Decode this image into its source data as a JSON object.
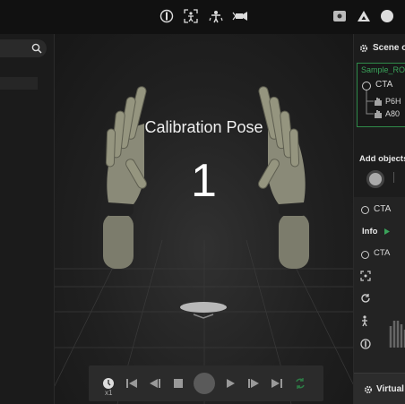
{
  "toolbar": {
    "icons": [
      "record-mode-icon",
      "body-tracking-icon",
      "retarget-icon",
      "camera-icon",
      "screenshot-icon",
      "vive-logo-icon",
      "profile-icon"
    ]
  },
  "viewport": {
    "pose_label": "Calibration Pose",
    "countdown": "1"
  },
  "playback": {
    "speed": "x1",
    "icons": [
      "timer-icon",
      "skip-back-icon",
      "step-back-icon",
      "stop-icon",
      "record-button-icon",
      "play-icon",
      "step-forward-icon",
      "skip-forward-icon",
      "loop-icon"
    ]
  },
  "scene_panel": {
    "title": "Scene o",
    "tree_root": "Sample_RO",
    "tree_items": [
      "CTA",
      "P6H",
      "A80"
    ],
    "add_objects": "Add objects",
    "selected_object": "CTA",
    "info_label": "Info",
    "info_object": "CTA",
    "virtual_label": "Virtual"
  }
}
